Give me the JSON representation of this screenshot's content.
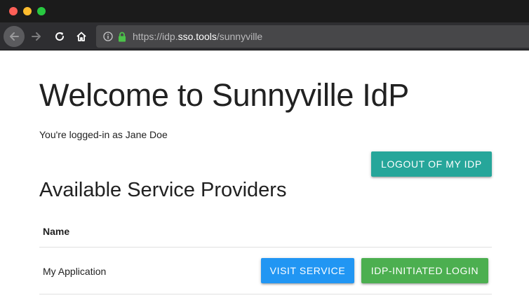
{
  "browser": {
    "url_prefix": "https://idp.",
    "url_host": "sso.tools",
    "url_path": "/sunnyville"
  },
  "page": {
    "title": "Welcome to Sunnyville IdP",
    "logged_in_text": "You're logged-in as Jane Doe",
    "logout_label": "LOGOUT OF MY IDP",
    "section_title": "Available Service Providers"
  },
  "table": {
    "header_name": "Name",
    "rows": [
      {
        "name": "My Application",
        "visit_label": "VISIT SERVICE",
        "idp_label": "IDP-INITIATED LOGIN"
      }
    ]
  },
  "colors": {
    "logout": "#26a69a",
    "visit": "#2196f3",
    "idp_login": "#4caf50",
    "lock": "#4cc34a"
  }
}
